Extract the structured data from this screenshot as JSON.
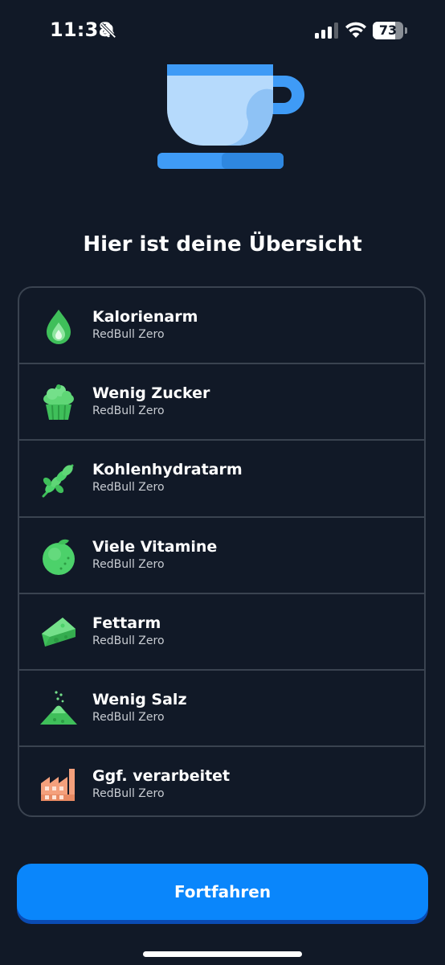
{
  "status_bar": {
    "time": "11:38",
    "battery_level": "73",
    "battery_fraction": 0.73,
    "icons": [
      "bell-slash-icon",
      "cellular-signal-icon",
      "wifi-icon",
      "battery-icon"
    ]
  },
  "hero": {
    "illustration": "coffee-cup-icon"
  },
  "title": "Hier ist deine Übersicht",
  "summary": {
    "items": [
      {
        "title": "Kalorienarm",
        "subtitle": "RedBull Zero",
        "icon": "flame-drop-icon"
      },
      {
        "title": "Wenig Zucker",
        "subtitle": "RedBull Zero",
        "icon": "cupcake-icon"
      },
      {
        "title": "Kohlenhydratarm",
        "subtitle": "RedBull Zero",
        "icon": "wheat-icon"
      },
      {
        "title": "Viele Vitamine",
        "subtitle": "RedBull Zero",
        "icon": "lime-icon"
      },
      {
        "title": "Fettarm",
        "subtitle": "RedBull Zero",
        "icon": "cheese-icon"
      },
      {
        "title": "Wenig Salz",
        "subtitle": "RedBull Zero",
        "icon": "salt-pile-icon"
      },
      {
        "title": "Ggf. verarbeitet",
        "subtitle": "RedBull Zero",
        "icon": "factory-icon"
      }
    ]
  },
  "continue_button": {
    "label": "Fortfahren"
  },
  "colors": {
    "background": "#111927",
    "card_border": "#3a4350",
    "accent_blue": "#0a86fb",
    "icon_green": "#4cd16a",
    "icon_orange": "#f4a07c"
  }
}
